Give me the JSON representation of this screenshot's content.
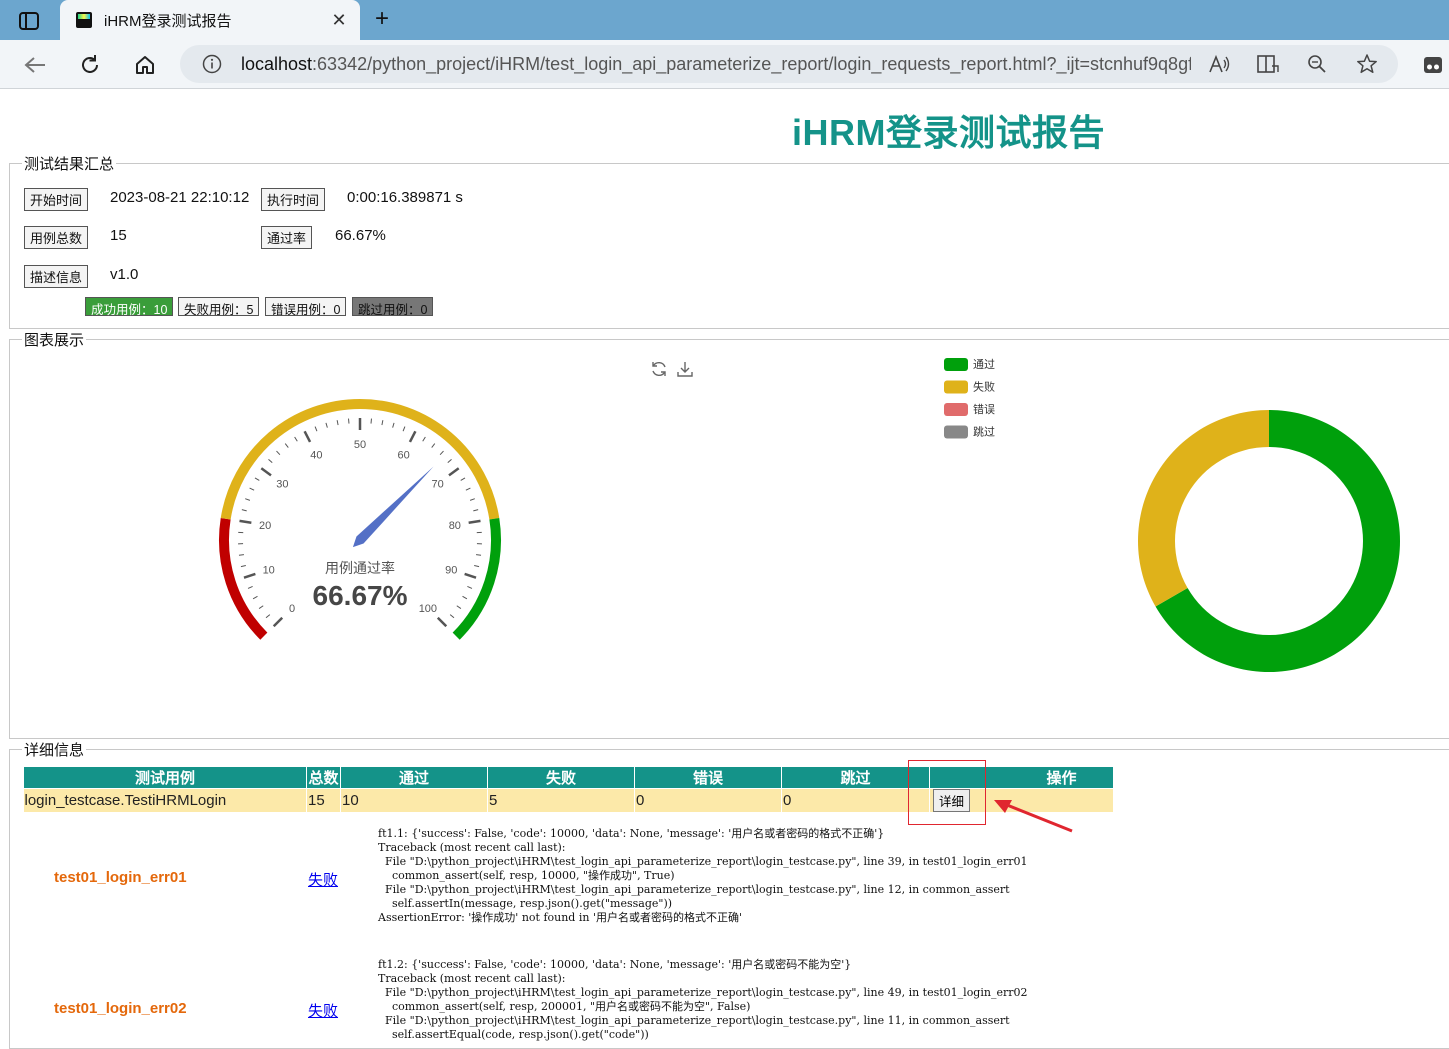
{
  "browser": {
    "tab_title": "iHRM登录测试报告",
    "tab_close_glyph": "✕",
    "new_tab_glyph": "+",
    "url_host": "localhost",
    "url_rest": ":63342/python_project/iHRM/test_login_api_parameterize_report/login_requests_report.html?_ijt=stcnhuf9q8gfg...",
    "icons": [
      "tab-actions-icon",
      "back-icon",
      "refresh-icon",
      "home-icon",
      "info-icon",
      "read-aloud-icon",
      "immersive-reader-icon",
      "zoom-icon",
      "favorite-icon",
      "extension-icon"
    ]
  },
  "report": {
    "title": "iHRM登录测试报告",
    "summary": {
      "legend": "测试结果汇总",
      "start_label": "开始时间",
      "start_value": "2023-08-21 22:10:12",
      "duration_label": "执行时间",
      "duration_value": "0:00:16.389871 s",
      "total_label": "用例总数",
      "total_value": "15",
      "pass_rate_label": "通过率",
      "pass_rate_value": "66.67%",
      "desc_label": "描述信息",
      "desc_value": "v1.0",
      "badges": {
        "success": "成功用例：10",
        "fail": "失败用例：5",
        "error": "错误用例：0",
        "skip": "跳过用例：0"
      }
    },
    "charts_legend": "图表展示",
    "details_legend": "详细信息",
    "colors": {
      "accent": "#149389",
      "pass": "#00a00c",
      "fail": "#dfb21a",
      "error": "#e06b6b",
      "skip": "#888888",
      "gauge_red": "#c00000",
      "needle": "#5470c6"
    }
  },
  "chart_data": [
    {
      "type": "gauge",
      "title": "用例通过率",
      "value": 66.67,
      "value_label": "66.67%",
      "min": 0,
      "max": 100,
      "major_ticks": [
        "0",
        "10",
        "20",
        "30",
        "40",
        "50",
        "60",
        "70",
        "80",
        "90",
        "100"
      ],
      "color_bands": [
        {
          "from": 0,
          "to": 20,
          "color": "#c00000"
        },
        {
          "from": 20,
          "to": 80,
          "color": "#dfb21a"
        },
        {
          "from": 80,
          "to": 100,
          "color": "#00a00c"
        }
      ]
    },
    {
      "type": "pie",
      "donut": true,
      "legend_position": "top",
      "categories": [
        "通过",
        "失败",
        "错误",
        "跳过"
      ],
      "values": [
        10,
        5,
        0,
        0
      ],
      "colors": [
        "#00a00c",
        "#dfb21a",
        "#e06b6b",
        "#888888"
      ]
    }
  ],
  "table": {
    "headers": [
      "测试用例",
      "总数",
      "通过",
      "失败",
      "错误",
      "跳过",
      "操作"
    ],
    "row": {
      "name": "login_testcase.TestiHRMLogin",
      "total": "15",
      "pass": "10",
      "fail": "5",
      "error": "0",
      "skip": "0",
      "button": "详细"
    }
  },
  "cases": [
    {
      "name": "test01_login_err01",
      "status": "失败",
      "log": "ft1.1: {'success': False, 'code': 10000, 'data': None, 'message': '用户名或者密码的格式不正确'}\nTraceback (most recent call last):\n  File \"D:\\python_project\\iHRM\\test_login_api_parameterize_report\\login_testcase.py\", line 39, in test01_login_err01\n    common_assert(self, resp, 10000, \"操作成功\", True)\n  File \"D:\\python_project\\iHRM\\test_login_api_parameterize_report\\login_testcase.py\", line 12, in common_assert\n    self.assertIn(message, resp.json().get(\"message\"))\nAssertionError: '操作成功' not found in '用户名或者密码的格式不正确'"
    },
    {
      "name": "test01_login_err02",
      "status": "失败",
      "log": "ft1.2: {'success': False, 'code': 10000, 'data': None, 'message': '用户名或密码不能为空'}\nTraceback (most recent call last):\n  File \"D:\\python_project\\iHRM\\test_login_api_parameterize_report\\login_testcase.py\", line 49, in test01_login_err02\n    common_assert(self, resp, 200001, \"用户名或密码不能为空\", False)\n  File \"D:\\python_project\\iHRM\\test_login_api_parameterize_report\\login_testcase.py\", line 11, in common_assert\n    self.assertEqual(code, resp.json().get(\"code\"))"
    }
  ]
}
